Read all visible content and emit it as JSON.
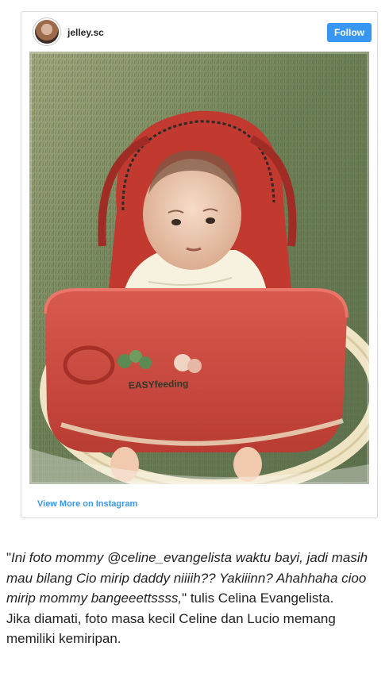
{
  "instagram": {
    "username": "jelley.sc",
    "follow_label": "Follow",
    "view_more_label": "View More on Instagram",
    "walker_label": "EASYfeeding"
  },
  "caption": {
    "quote_open": "\"",
    "quote_italic": "Ini foto mommy @celine_evangelista waktu bayi, jadi masih mau bilang Cio mirip daddy niiiih?? Yakiiinn? Ahahhaha cioo mirip mommy bangeeettssss,",
    "quote_close_attr": "\" tulis Celina Evangelista.",
    "body": "Jika diamati, foto masa kecil Celine dan Lucio memang memiliki kemiripan."
  },
  "colors": {
    "follow_button": "#3897f0",
    "link": "#3897f0",
    "caption_text": "#222222",
    "walker_red": "#c9423a"
  }
}
